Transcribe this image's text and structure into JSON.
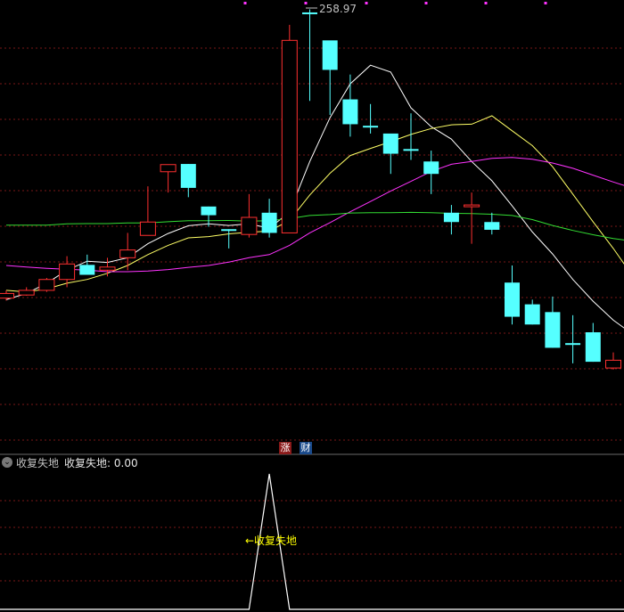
{
  "chart_data": {
    "type": "candlestick",
    "price_label": "258.97",
    "candles": [
      {
        "o": 166.0,
        "h": 168.5,
        "l": 165.2,
        "c": 167.5,
        "color": "up"
      },
      {
        "o": 167.0,
        "h": 169.5,
        "l": 166.8,
        "c": 168.5,
        "color": "up"
      },
      {
        "o": 168.5,
        "h": 172.5,
        "l": 168.0,
        "c": 172.0,
        "color": "up"
      },
      {
        "o": 172.0,
        "h": 179.5,
        "l": 169.5,
        "c": 177.0,
        "color": "up"
      },
      {
        "o": 176.7,
        "h": 180.0,
        "l": 175.0,
        "c": 173.5,
        "color": "down"
      },
      {
        "o": 175.0,
        "h": 179.0,
        "l": 173.0,
        "c": 176.0,
        "color": "up"
      },
      {
        "o": 179.0,
        "h": 187.0,
        "l": 175.0,
        "c": 181.5,
        "color": "up"
      },
      {
        "o": 190.5,
        "h": 202.0,
        "l": 188.0,
        "c": 186.2,
        "color": "up"
      },
      {
        "o": 206.7,
        "h": 209.0,
        "l": 200.0,
        "c": 209.0,
        "color": "up"
      },
      {
        "o": 209.2,
        "h": 209.2,
        "l": 198.5,
        "c": 201.5,
        "color": "down"
      },
      {
        "o": 195.5,
        "h": 195.5,
        "l": 189.0,
        "c": 192.7,
        "color": "down"
      },
      {
        "o": 188.2,
        "h": 188.2,
        "l": 182.0,
        "c": 188.0,
        "color": "down"
      },
      {
        "o": 192.0,
        "h": 199.5,
        "l": 185.5,
        "c": 186.5,
        "color": "up"
      },
      {
        "o": 193.5,
        "h": 198.0,
        "l": 185.5,
        "c": 187.0,
        "color": "down"
      },
      {
        "o": 187.0,
        "h": 254.0,
        "l": 187.0,
        "c": 249.0,
        "color": "up"
      },
      {
        "o": 258.0,
        "h": 258.97,
        "l": 229.5,
        "c": 258.0,
        "color": "down"
      },
      {
        "o": 239.5,
        "h": 241.0,
        "l": 225.0,
        "c": 249.0,
        "color": "down"
      },
      {
        "o": 222.0,
        "h": 238.0,
        "l": 218.0,
        "c": 230.0,
        "color": "down"
      },
      {
        "o": 221.5,
        "h": 228.5,
        "l": 219.0,
        "c": 221.5,
        "color": "down"
      },
      {
        "o": 212.5,
        "h": 215.5,
        "l": 206.0,
        "c": 219.0,
        "color": "down"
      },
      {
        "o": 214.0,
        "h": 225.5,
        "l": 210.5,
        "c": 214.0,
        "color": "down"
      },
      {
        "o": 210.0,
        "h": 213.5,
        "l": 199.5,
        "c": 206.0,
        "color": "down"
      },
      {
        "o": 193.5,
        "h": 196.0,
        "l": 186.5,
        "c": 190.5,
        "color": "down"
      },
      {
        "o": 195.5,
        "h": 200.0,
        "l": 183.5,
        "c": 196.0,
        "color": "up"
      },
      {
        "o": 188.0,
        "h": 193.5,
        "l": 186.5,
        "c": 190.5,
        "color": "down"
      },
      {
        "o": 171.0,
        "h": 176.5,
        "l": 157.5,
        "c": 160.0,
        "color": "down"
      },
      {
        "o": 164.0,
        "h": 165.5,
        "l": 157.5,
        "c": 157.5,
        "color": "down"
      },
      {
        "o": 161.5,
        "h": 166.5,
        "l": 150.0,
        "c": 150.0,
        "color": "down"
      },
      {
        "o": 151.5,
        "h": 160.5,
        "l": 145.0,
        "c": 151.0,
        "color": "down"
      },
      {
        "o": 155.0,
        "h": 158.0,
        "l": 145.5,
        "c": 145.5,
        "color": "down"
      },
      {
        "o": 143.5,
        "h": 148.5,
        "l": 143.0,
        "c": 146.0,
        "color": "up"
      },
      {
        "o": 142.5,
        "h": 143.0,
        "l": 138.0,
        "c": 138.0,
        "color": "down"
      }
    ],
    "ma_lines": [
      {
        "color": "#ffffff",
        "values": [
          165.5,
          167.5,
          170.8,
          175.0,
          177.9,
          177.5,
          179.0,
          183.5,
          186.8,
          189.3,
          189.9,
          189.4,
          189.9,
          188.5,
          193.7,
          210.0,
          224.1,
          235.0,
          241.0,
          238.8,
          227.3,
          221.2,
          217.2,
          210.0,
          203.8,
          195.7,
          187.3,
          180.2,
          172.0,
          165.0,
          158.9,
          154.2
        ]
      },
      {
        "color": "#ffff66",
        "values": [
          168.5,
          168.0,
          169.0,
          170.8,
          172.0,
          174.0,
          176.5,
          180.0,
          183.0,
          185.4,
          185.8,
          186.7,
          187.2,
          187.6,
          191.0,
          199.2,
          206.2,
          211.9,
          214.2,
          216.4,
          218.7,
          220.6,
          221.8,
          222.0,
          224.7,
          219.9,
          215.1,
          208.3,
          199.5,
          190.6,
          182.0,
          172.7
        ]
      },
      {
        "color": "#ff33ff",
        "values": [
          176.5,
          176.0,
          175.6,
          175.3,
          175.0,
          174.5,
          174.5,
          174.7,
          175.2,
          175.9,
          176.5,
          177.6,
          179.0,
          180.0,
          183.0,
          187.0,
          190.3,
          193.8,
          197.1,
          200.5,
          203.6,
          206.8,
          209.1,
          210.0,
          211.0,
          211.3,
          210.7,
          209.5,
          207.8,
          205.6,
          203.4,
          201.3
        ]
      },
      {
        "color": "#33dd33",
        "values": [
          189.5,
          189.5,
          189.5,
          189.9,
          190.0,
          190.0,
          190.2,
          190.2,
          190.6,
          190.9,
          190.9,
          191.0,
          190.8,
          190.9,
          191.6,
          192.6,
          192.9,
          193.4,
          193.5,
          193.5,
          193.6,
          193.5,
          193.3,
          193.2,
          193.0,
          192.6,
          191.3,
          189.4,
          187.8,
          186.4,
          185.2,
          184.3
        ]
      }
    ],
    "ylim": [
      120,
      262
    ],
    "indicator": {
      "name": "收复失地",
      "reading": "收复失地: 0.00",
      "annotation": "←收复失地",
      "values": [
        0,
        0,
        0,
        0,
        0,
        0,
        0,
        0,
        0,
        0,
        0,
        0,
        0,
        1,
        0,
        0,
        0,
        0,
        0,
        0,
        0,
        0,
        0,
        0,
        0,
        0,
        0,
        0,
        0,
        0,
        0,
        0
      ],
      "ylim": [
        0,
        1
      ]
    },
    "markers": [
      "涨",
      "财"
    ],
    "colors": {
      "up": "#ff3030",
      "down": "#55ffff",
      "grid": "#7a1818",
      "annotation": "#ffff00",
      "indicator_line": "#ffffff",
      "marker_dots": "#ff33ff"
    }
  }
}
